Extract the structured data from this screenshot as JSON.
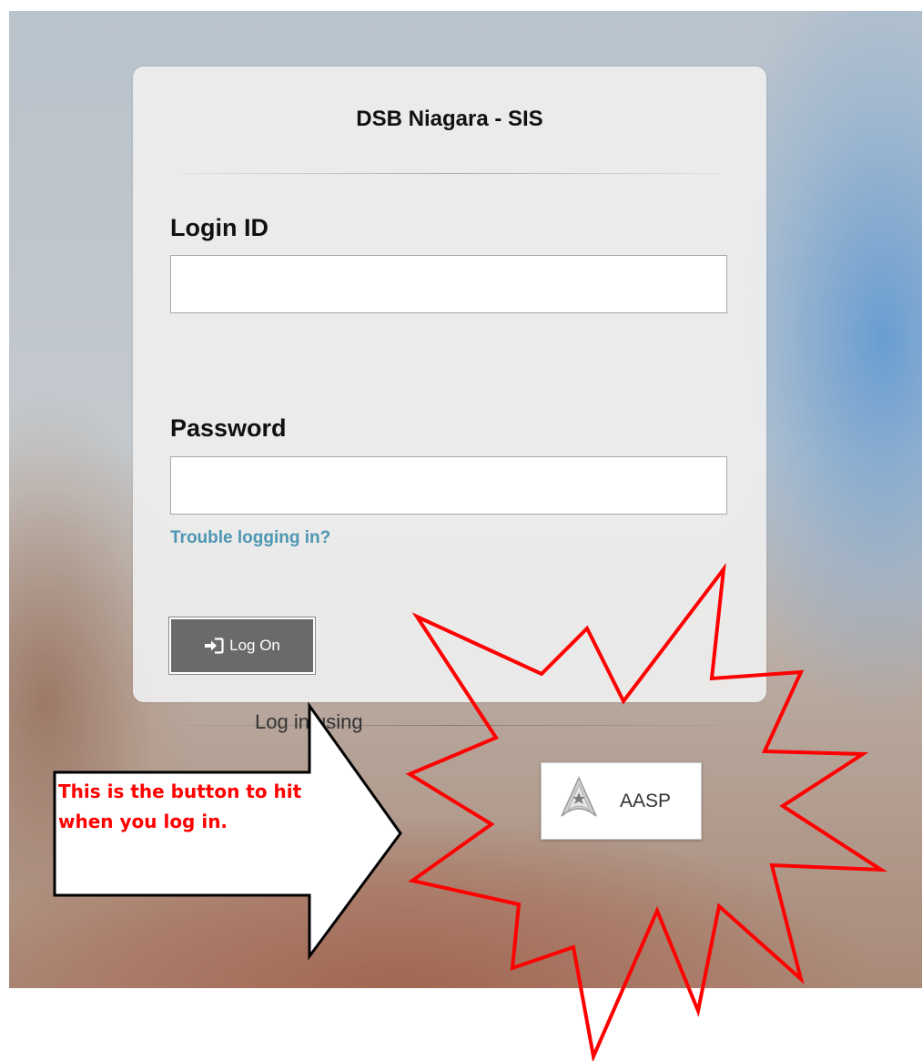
{
  "login_card": {
    "title": "DSB Niagara - SIS",
    "login_id_label": "Login ID",
    "login_id_value": "",
    "password_label": "Password",
    "password_value": "",
    "trouble_link": "Trouble logging in?",
    "logon_button_label": "Log On",
    "login_using_label": "Log in using",
    "aasp_button_label": "AASP"
  },
  "annotation": {
    "callout_text_line1": "This is the button to hit",
    "callout_text_line2": "when you log in.",
    "starburst_color": "#ff0000",
    "callout_text_color": "#ff0000"
  },
  "icons": {
    "logon_icon": "sign-in-icon",
    "aasp_icon": "aasp-logo-icon"
  }
}
